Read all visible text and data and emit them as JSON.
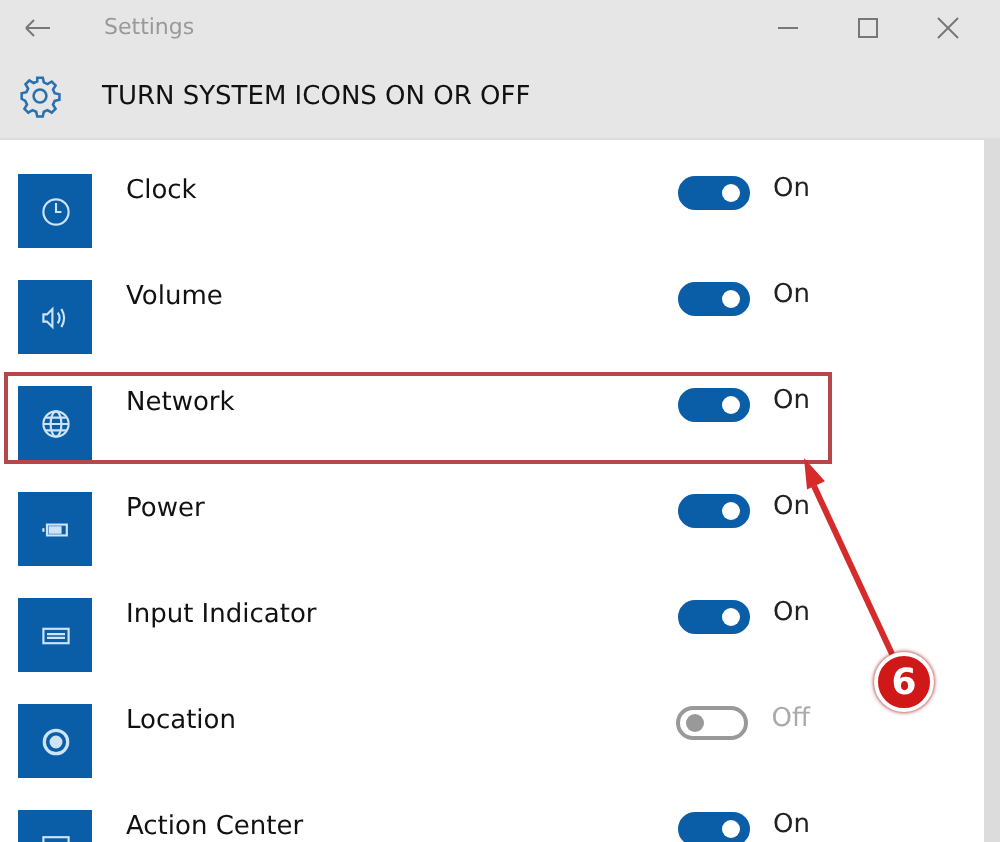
{
  "window": {
    "title": "Settings"
  },
  "header": {
    "title": "TURN SYSTEM ICONS ON OR OFF"
  },
  "items": [
    {
      "name": "Clock",
      "kind": "clock",
      "on": true,
      "state_label": "On",
      "highlighted": false
    },
    {
      "name": "Volume",
      "kind": "volume",
      "on": true,
      "state_label": "On",
      "highlighted": false
    },
    {
      "name": "Network",
      "kind": "network",
      "on": true,
      "state_label": "On",
      "highlighted": true
    },
    {
      "name": "Power",
      "kind": "power",
      "on": true,
      "state_label": "On",
      "highlighted": false
    },
    {
      "name": "Input Indicator",
      "kind": "input",
      "on": true,
      "state_label": "On",
      "highlighted": false
    },
    {
      "name": "Location",
      "kind": "location",
      "on": false,
      "state_label": "Off",
      "highlighted": false
    },
    {
      "name": "Action Center",
      "kind": "action",
      "on": true,
      "state_label": "On",
      "highlighted": false
    }
  ],
  "annotation": {
    "step": "6"
  }
}
